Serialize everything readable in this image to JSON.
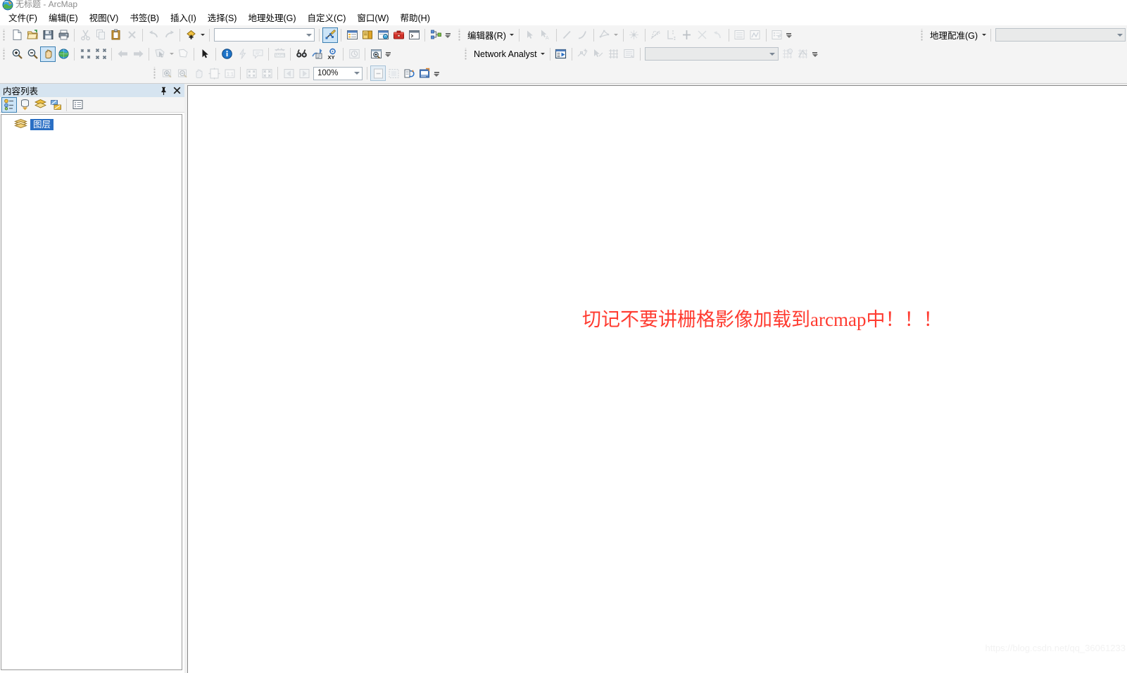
{
  "window": {
    "title": "无标题 - ArcMap",
    "app_icon": "arcmap-icon"
  },
  "menubar": {
    "items": [
      {
        "label": "文件(F)",
        "name": "menu-file"
      },
      {
        "label": "编辑(E)",
        "name": "menu-edit"
      },
      {
        "label": "视图(V)",
        "name": "menu-view"
      },
      {
        "label": "书签(B)",
        "name": "menu-bookmarks"
      },
      {
        "label": "插入(I)",
        "name": "menu-insert"
      },
      {
        "label": "选择(S)",
        "name": "menu-selection"
      },
      {
        "label": "地理处理(G)",
        "name": "menu-geoprocessing"
      },
      {
        "label": "自定义(C)",
        "name": "menu-customize"
      },
      {
        "label": "窗口(W)",
        "name": "menu-window"
      },
      {
        "label": "帮助(H)",
        "name": "menu-help"
      }
    ]
  },
  "toolbars": {
    "standard": {
      "name": "standard-toolbar",
      "scale_combo": {
        "value": "",
        "name": "map-scale-combo"
      }
    },
    "editor": {
      "label": "编辑器(R)",
      "name": "editor-toolbar"
    },
    "tools": {
      "name": "tools-toolbar"
    },
    "network_analyst": {
      "label": "Network Analyst",
      "name": "network-analyst-toolbar",
      "combo": {
        "value": "",
        "name": "network-dataset-combo"
      }
    },
    "georeferencing": {
      "label": "地理配准(G)",
      "name": "georeferencing-toolbar",
      "combo": {
        "value": "",
        "name": "georeferencing-layer-combo"
      }
    },
    "layout": {
      "name": "layout-toolbar",
      "zoom_combo": {
        "value": "100%",
        "name": "layout-zoom-combo"
      }
    }
  },
  "toc": {
    "title": "内容列表",
    "name": "table-of-contents-panel",
    "pin_icon": "pin-icon",
    "close_icon": "close-icon",
    "view_buttons": [
      {
        "name": "toc-list-by-drawing-order",
        "icon": "drawing-order-icon"
      },
      {
        "name": "toc-list-by-source",
        "icon": "source-icon"
      },
      {
        "name": "toc-list-by-visibility",
        "icon": "visibility-icon"
      },
      {
        "name": "toc-list-by-selection",
        "icon": "selection-icon"
      },
      {
        "name": "toc-options",
        "icon": "options-icon"
      }
    ],
    "tree": [
      {
        "label": "图层",
        "name": "toc-layers-node",
        "icon": "layers-icon",
        "selected": true
      }
    ]
  },
  "map": {
    "name": "map-canvas",
    "annotation": "切记不要讲栅格影像加载到arcmap中！！！",
    "annotation_color": "#ff3b30",
    "watermark": "https://blog.csdn.net/qq_36061233"
  }
}
